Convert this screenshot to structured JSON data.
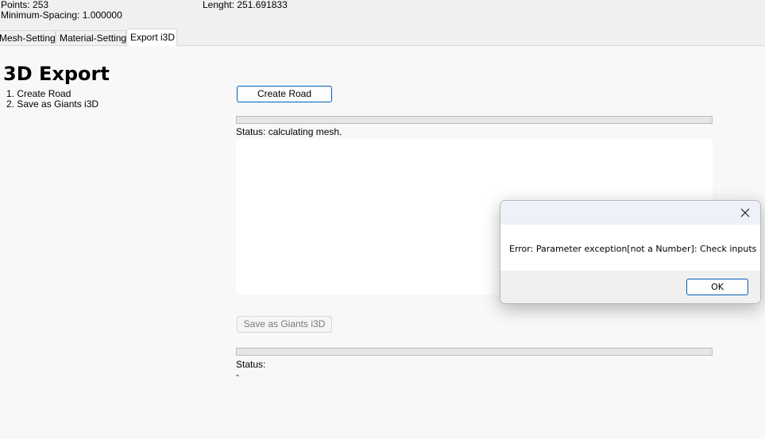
{
  "info": {
    "points": "Points: 253",
    "min_spacing": "Minimum-Spacing: 1.000000",
    "length": "Lenght: 251.691833"
  },
  "tabs": [
    {
      "label": "Mesh-Settings",
      "active": false
    },
    {
      "label": "Material-Settings",
      "active": false
    },
    {
      "label": "Export i3D",
      "active": true
    }
  ],
  "export": {
    "title": "3D Export",
    "steps": [
      "1. Create Road",
      "2. Save as Giants i3D"
    ],
    "create_button": "Create Road",
    "create_status": "Status: calculating mesh.",
    "save_button": "Save as Giants i3D",
    "save_status_label": "Status:",
    "save_status_value": "-"
  },
  "dialog": {
    "message": "Error: Parameter exception[not a Number]: Check inputs",
    "ok_label": "OK"
  },
  "icons": {
    "dialog_close": "close-icon"
  },
  "colors": {
    "window_bg": "#f8f8f8",
    "accent": "#005fb8",
    "dialog_title_bg": "#eef1f8"
  }
}
